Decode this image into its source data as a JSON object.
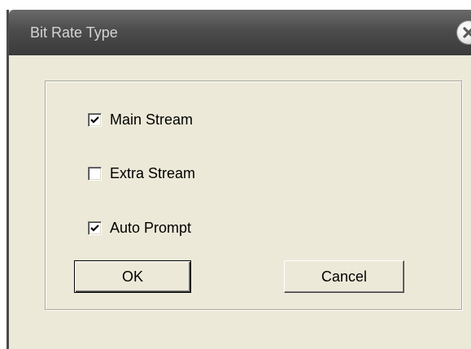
{
  "dialog": {
    "title": "Bit Rate Type",
    "close_icon": "close-icon"
  },
  "options": [
    {
      "label": "Main Stream",
      "checked": true
    },
    {
      "label": "Extra Stream",
      "checked": false
    },
    {
      "label": "Auto Prompt",
      "checked": true
    }
  ],
  "buttons": {
    "ok_label": "OK",
    "cancel_label": "Cancel"
  }
}
